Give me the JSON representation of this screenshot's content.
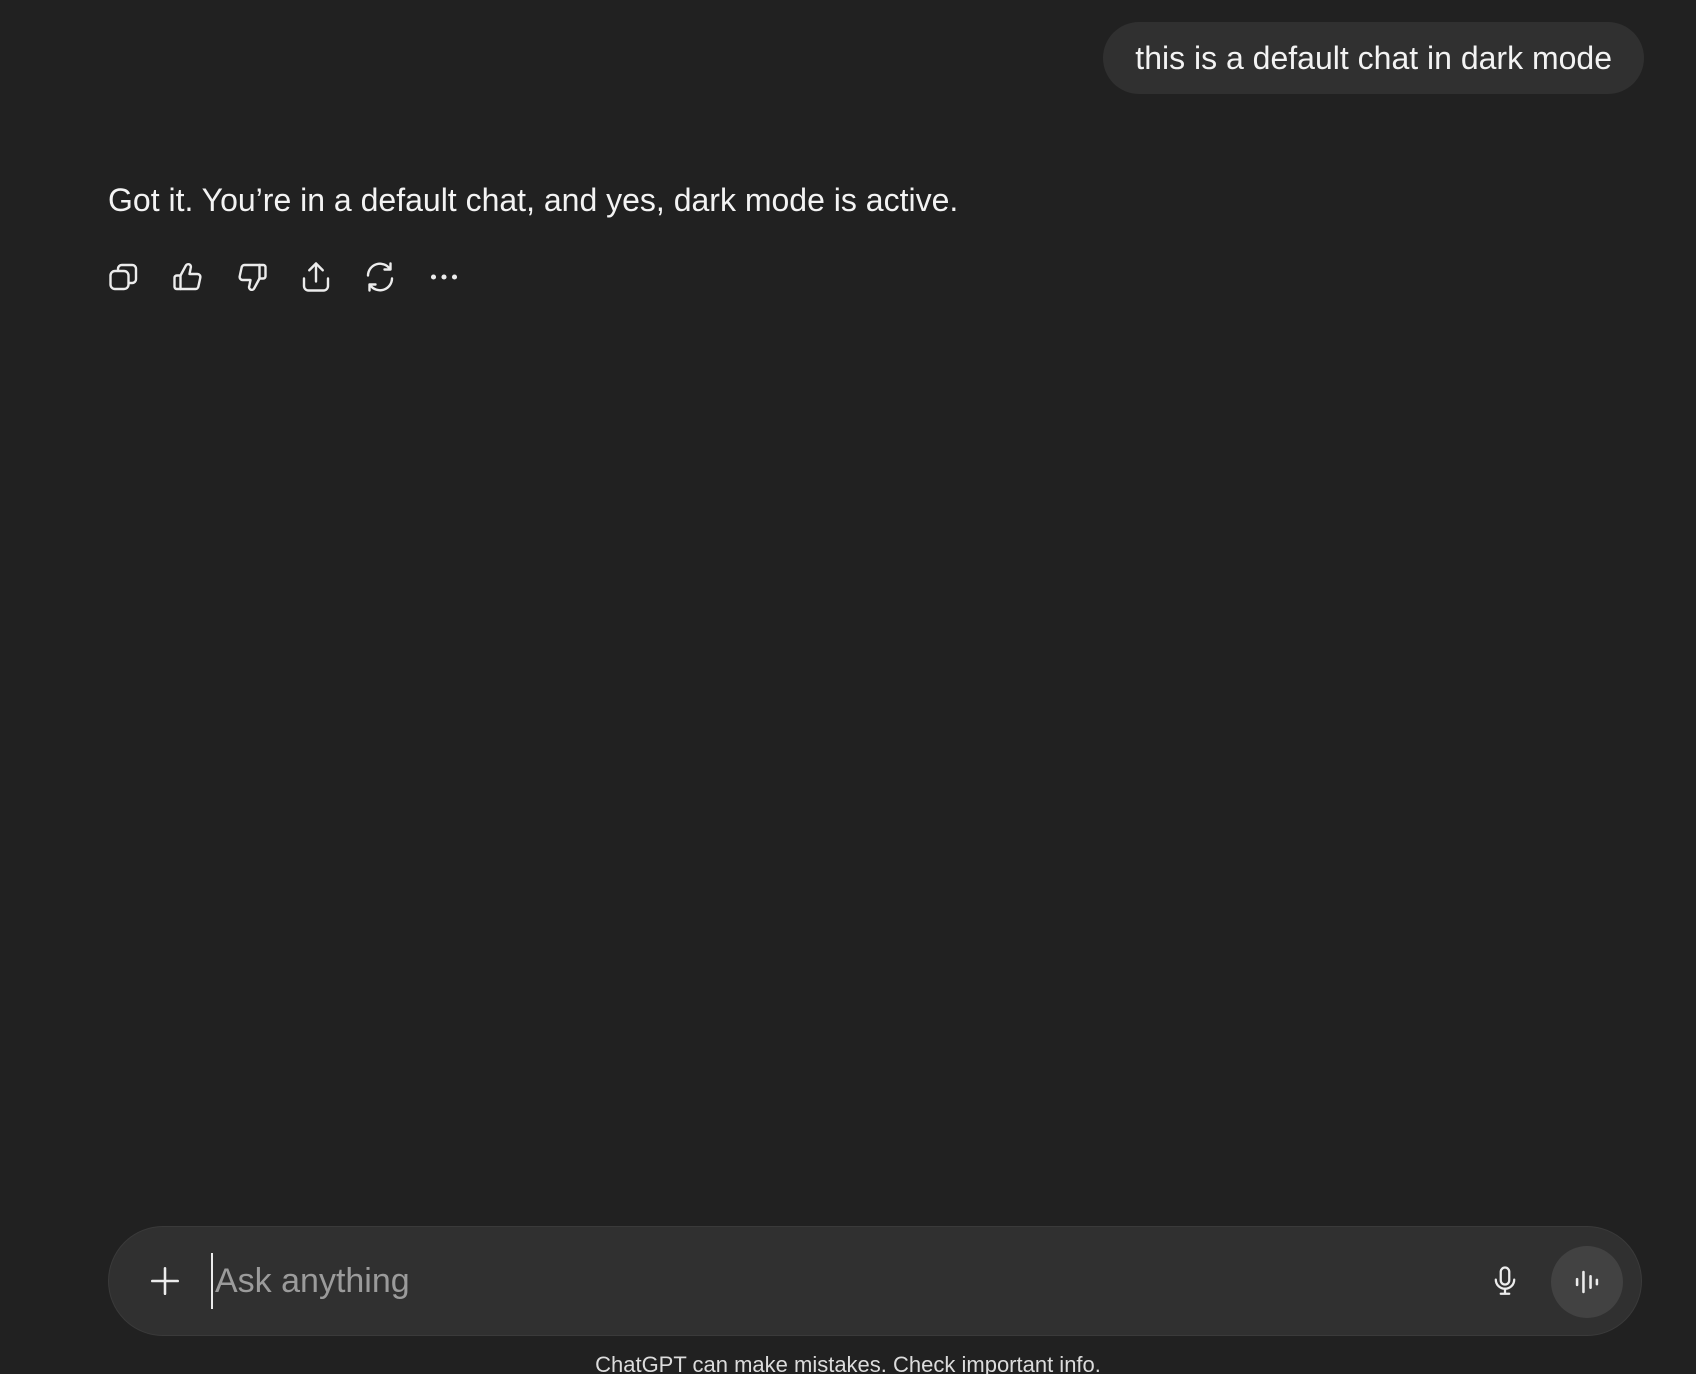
{
  "conversation": {
    "user_message": "this is a default chat in dark mode",
    "assistant_message": "Got it. You’re in a default chat, and yes, dark mode is active."
  },
  "message_actions": [
    {
      "name": "copy-icon",
      "label": "Copy"
    },
    {
      "name": "thumbs-up-icon",
      "label": "Good response"
    },
    {
      "name": "thumbs-down-icon",
      "label": "Bad response"
    },
    {
      "name": "share-icon",
      "label": "Share"
    },
    {
      "name": "regenerate-icon",
      "label": "Try again"
    },
    {
      "name": "more-icon",
      "label": "More actions"
    }
  ],
  "composer": {
    "placeholder": "Ask anything",
    "value": ""
  },
  "footer": {
    "disclaimer": "ChatGPT can make mistakes. Check important info."
  },
  "colors": {
    "background": "#212121",
    "bubble": "#303030",
    "composer": "#303030",
    "voice_button": "#424242",
    "text": "#ececec"
  }
}
